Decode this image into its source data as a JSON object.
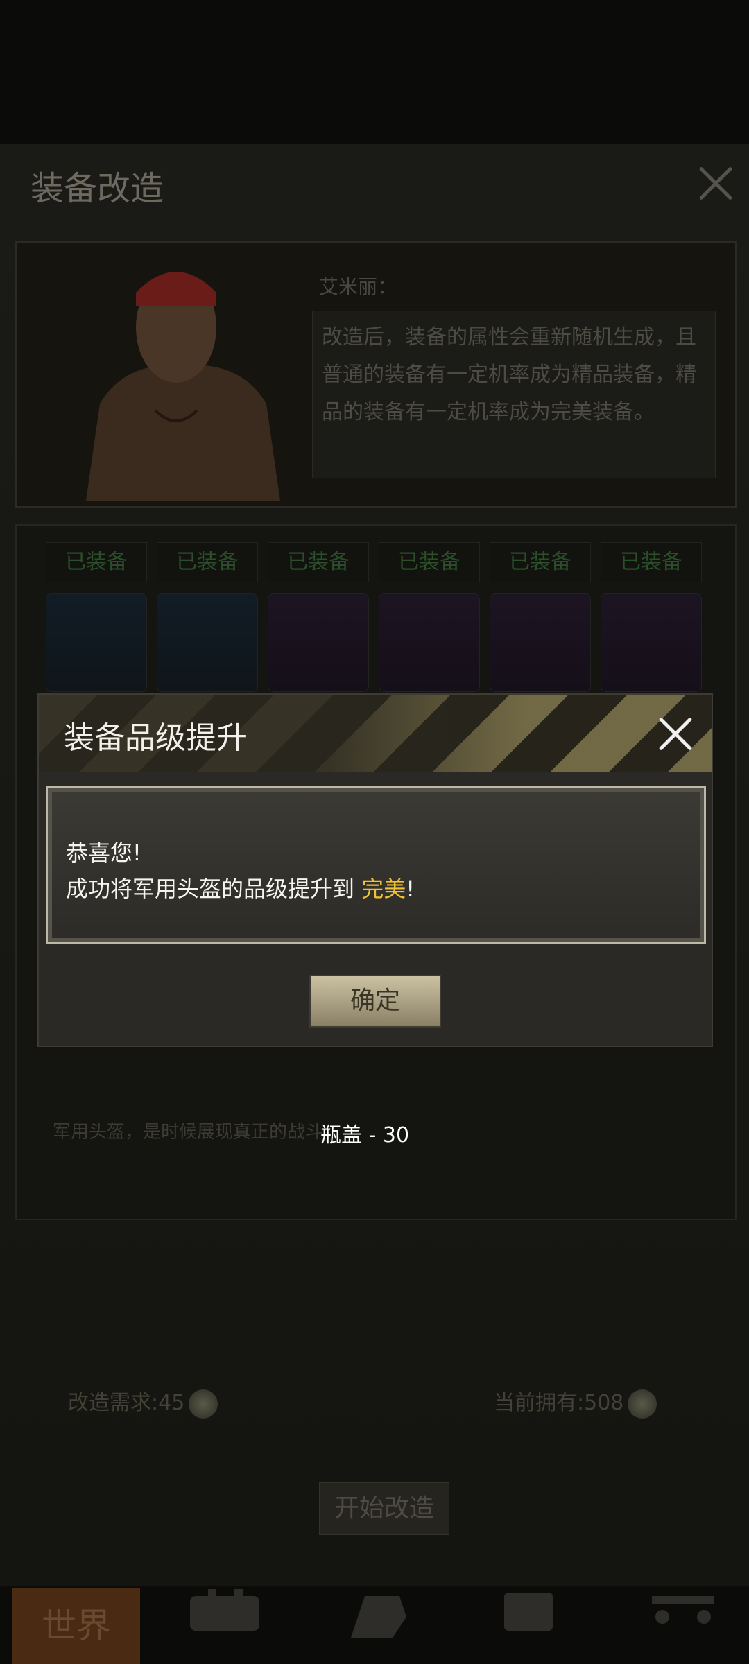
{
  "screen": {
    "title": "装备改造",
    "npc": {
      "name": "艾米丽：",
      "dialogue": "改造后，装备的属性会重新随机生成，且普通的装备有一定机率成为精品装备，精品的装备有一定机率成为完美装备。"
    },
    "equipment": [
      {
        "label": "已装备",
        "rarity": "blue"
      },
      {
        "label": "已装备",
        "rarity": "blue"
      },
      {
        "label": "已装备",
        "rarity": "purple"
      },
      {
        "label": "已装备",
        "rarity": "purple"
      },
      {
        "label": "已装备",
        "rarity": "purple"
      },
      {
        "label": "已装备",
        "rarity": "purple"
      }
    ],
    "item_description": "军用头盔，是时候展现真正的战斗",
    "requirement": {
      "label": "改造需求:45",
      "owned": "当前拥有:508"
    },
    "start_button": "开始改造",
    "nav": {
      "world": "世界"
    }
  },
  "dialog": {
    "title": "装备品级提升",
    "line1": "恭喜您!",
    "line2_prefix": "成功将军用头盔的品级提升到 ",
    "line2_highlight": "完美",
    "line2_suffix": "!",
    "confirm": "确定"
  },
  "toast": "瓶盖 - 30",
  "colors": {
    "highlight": "#f3c131",
    "equipped_text": "#2a4f2a"
  }
}
